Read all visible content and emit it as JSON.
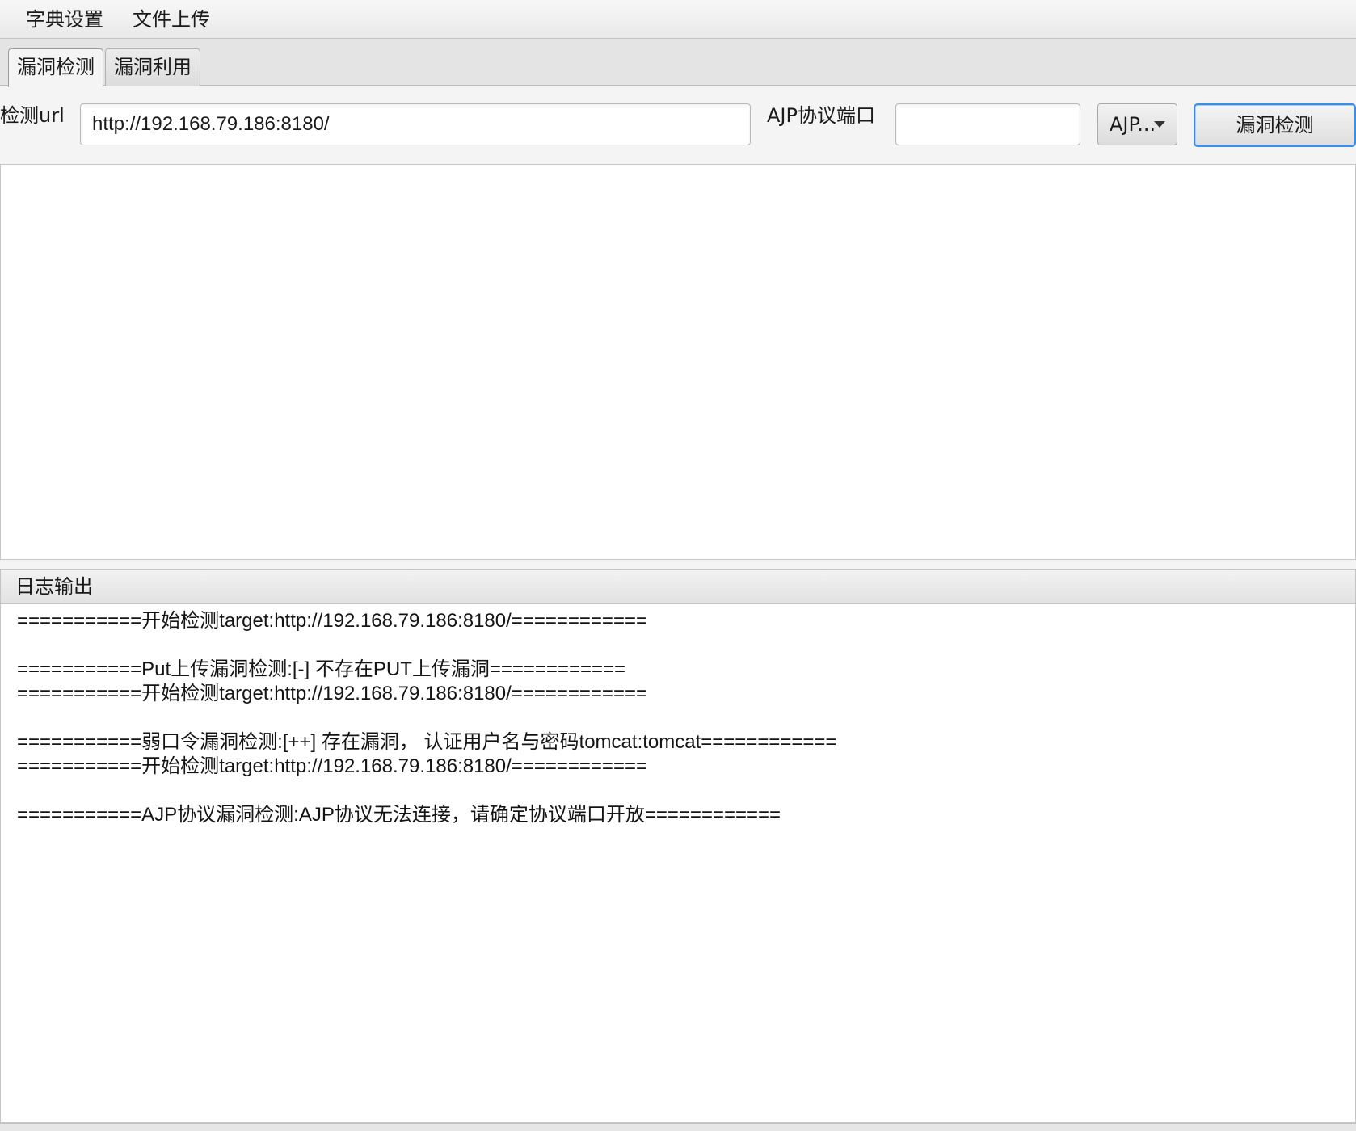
{
  "menu": {
    "items": [
      {
        "label": "字典设置"
      },
      {
        "label": "文件上传"
      }
    ]
  },
  "tabs": [
    {
      "label": "漏洞检测",
      "active": true
    },
    {
      "label": "漏洞利用",
      "active": false
    }
  ],
  "toolbar": {
    "url_label": "检测url",
    "url_value": "http://192.168.79.186:8180/",
    "ajp_port_label": "AJP协议端口",
    "ajp_port_value": "",
    "combo_value": "AJP...",
    "combo_icon": "chevron-down-icon",
    "detect_button_label": "漏洞检测"
  },
  "result": {
    "text": ""
  },
  "log": {
    "title": "日志输出",
    "lines": [
      "===========开始检测target:http://192.168.79.186:8180/============",
      "",
      "===========Put上传漏洞检测:[-] 不存在PUT上传漏洞============",
      "===========开始检测target:http://192.168.79.186:8180/============",
      "",
      "===========弱口令漏洞检测:[++] 存在漏洞， 认证用户名与密码tomcat:tomcat============",
      "===========开始检测target:http://192.168.79.186:8180/============",
      "",
      "===========AJP协议漏洞检测:AJP协议无法连接，请确定协议端口开放============"
    ]
  },
  "colors": {
    "focus_border": "#3a8ee6",
    "window_bg": "#f4f4f4",
    "field_bg": "#ffffff"
  }
}
